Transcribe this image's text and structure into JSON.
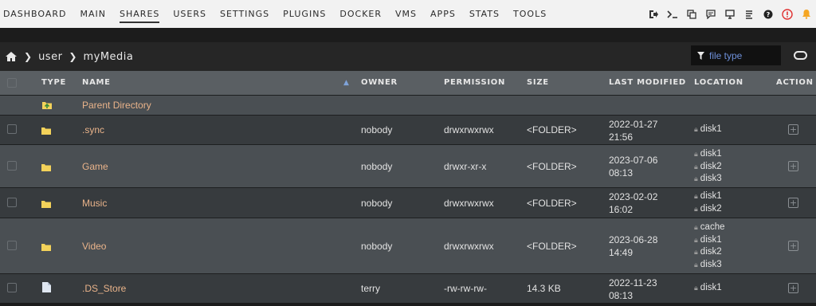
{
  "nav": {
    "items": [
      "DASHBOARD",
      "MAIN",
      "SHARES",
      "USERS",
      "SETTINGS",
      "PLUGINS",
      "DOCKER",
      "VMS",
      "APPS",
      "STATS",
      "TOOLS"
    ],
    "active": "SHARES",
    "icons": [
      "logout-icon",
      "terminal-icon",
      "copy-icon",
      "feedback-icon",
      "monitor-icon",
      "log-icon",
      "help-icon",
      "power-icon",
      "bell-icon"
    ]
  },
  "breadcrumb": {
    "items": [
      "user",
      "myMedia"
    ]
  },
  "filter": {
    "placeholder": "file type"
  },
  "table": {
    "headers": {
      "type": "TYPE",
      "name": "NAME",
      "owner": "OWNER",
      "permission": "PERMISSION",
      "size": "SIZE",
      "modified": "LAST MODIFIED",
      "location": "LOCATION",
      "action": "ACTION"
    },
    "parent": {
      "label": "Parent Directory"
    },
    "rows": [
      {
        "name": ".sync",
        "owner": "nobody",
        "permission": "drwxrwxrwx",
        "size": "<FOLDER>",
        "date": "2022-01-27",
        "time": "21:56",
        "locations": [
          "disk1"
        ]
      },
      {
        "name": "Game",
        "owner": "nobody",
        "permission": "drwxr-xr-x",
        "size": "<FOLDER>",
        "date": "2023-07-06",
        "time": "08:13",
        "locations": [
          "disk1",
          "disk2",
          "disk3"
        ]
      },
      {
        "name": "Music",
        "owner": "nobody",
        "permission": "drwxrwxrwx",
        "size": "<FOLDER>",
        "date": "2023-02-02",
        "time": "16:02",
        "locations": [
          "disk1",
          "disk2"
        ]
      },
      {
        "name": "Video",
        "owner": "nobody",
        "permission": "drwxrwxrwx",
        "size": "<FOLDER>",
        "date": "2023-06-28",
        "time": "14:49",
        "locations": [
          "cache",
          "disk1",
          "disk2",
          "disk3"
        ]
      },
      {
        "name": ".DS_Store",
        "owner": "terry",
        "permission": "-rw-rw-rw-",
        "size": "14.3 KB",
        "date": "2022-11-23",
        "time": "08:13",
        "locations": [
          "disk1"
        ]
      }
    ]
  },
  "colors": {
    "header": "#5a5f63",
    "row_light": "#4a4f53",
    "row_dark": "#373b3e",
    "name": "#e9b38a",
    "folder": "#f3d25a",
    "alert": "#e03131",
    "bell": "#f5a623"
  }
}
